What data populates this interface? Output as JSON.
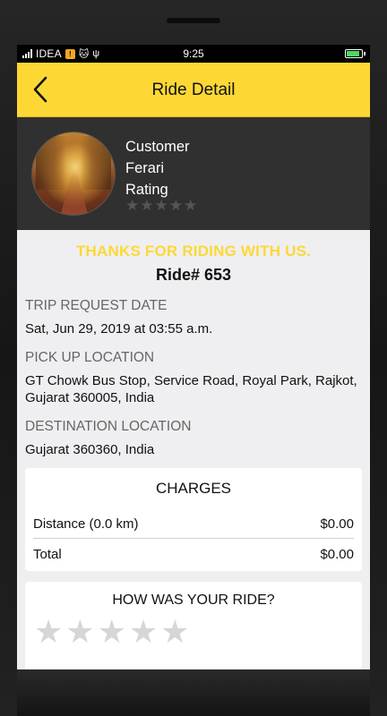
{
  "status_bar": {
    "carrier": "IDEA",
    "carrier_badge": "!",
    "time": "9:25"
  },
  "header": {
    "back_icon": "chevron-left-icon",
    "title": "Ride Detail"
  },
  "profile": {
    "line1": "Customer",
    "line2": "Ferari",
    "line3": "Rating",
    "rating_stars": [
      "★",
      "★",
      "★",
      "★",
      "★"
    ]
  },
  "ride": {
    "thanks": "THANKS FOR RIDING WITH US.",
    "number": "Ride# 653"
  },
  "trip": {
    "request_label": "TRIP REQUEST DATE",
    "request_value": "Sat, Jun 29, 2019 at 03:55 a.m.",
    "pickup_label": "PICK UP LOCATION",
    "pickup_value": "GT Chowk Bus Stop, Service Road, Royal Park, Rajkot, Gujarat 360005, India",
    "dest_label": "DESTINATION LOCATION",
    "dest_value": "Gujarat 360360, India"
  },
  "charges": {
    "title": "CHARGES",
    "distance_label": "Distance (0.0 km)",
    "distance_value": "$0.00",
    "total_label": "Total",
    "total_value": "$0.00"
  },
  "feedback": {
    "title": "HOW WAS YOUR RIDE?",
    "stars": [
      "★",
      "★",
      "★",
      "★",
      "★"
    ]
  },
  "colors": {
    "accent": "#fdd835",
    "header_dark": "#303030",
    "background": "#efeff1"
  }
}
